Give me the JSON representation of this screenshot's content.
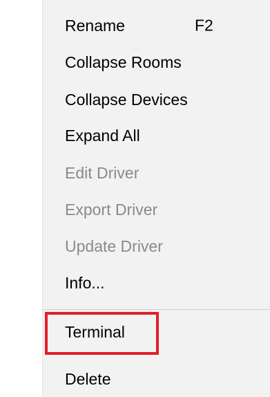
{
  "context_menu": {
    "items": [
      {
        "label": "Rename",
        "shortcut": "F2",
        "enabled": true
      },
      {
        "label": "Collapse Rooms",
        "shortcut": "",
        "enabled": true
      },
      {
        "label": "Collapse Devices",
        "shortcut": "",
        "enabled": true
      },
      {
        "label": "Expand All",
        "shortcut": "",
        "enabled": true
      },
      {
        "label": "Edit Driver",
        "shortcut": "",
        "enabled": false
      },
      {
        "label": "Export Driver",
        "shortcut": "",
        "enabled": false
      },
      {
        "label": "Update Driver",
        "shortcut": "",
        "enabled": false
      },
      {
        "label": "Info...",
        "shortcut": "",
        "enabled": true
      },
      {
        "label": "Terminal",
        "shortcut": "",
        "enabled": true
      },
      {
        "label": "Delete",
        "shortcut": "",
        "enabled": true
      }
    ]
  },
  "highlight": {
    "target": "Terminal",
    "color": "#e0202a"
  },
  "colors": {
    "menu_background": "#f2f2f2",
    "enabled_text": "#000000",
    "disabled_text": "#8a8a8a"
  }
}
